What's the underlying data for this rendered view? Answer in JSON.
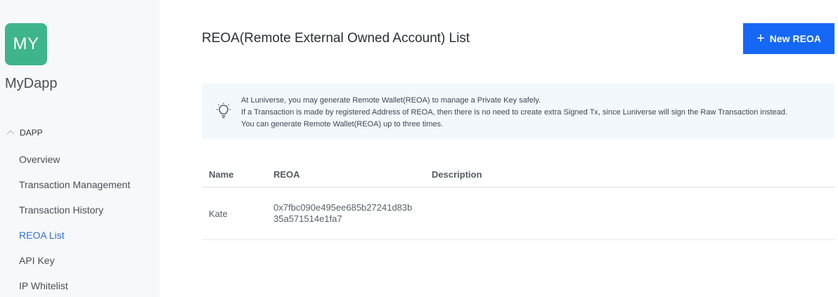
{
  "sidebar": {
    "avatar_text": "MY",
    "app_name": "MyDapp",
    "section_label": "DAPP",
    "items": [
      {
        "label": "Overview"
      },
      {
        "label": "Transaction Management"
      },
      {
        "label": "Transaction History"
      },
      {
        "label": "REOA List"
      },
      {
        "label": "API Key"
      },
      {
        "label": "IP Whitelist"
      }
    ],
    "active_item": "REOA List",
    "avatar_color": "#3fb58b",
    "active_color": "#2f6fd6"
  },
  "header": {
    "title": "REOA(Remote External Owned Account) List",
    "new_button_label": "New REOA",
    "button_color": "#1468f5"
  },
  "info": {
    "icon": "lightbulb-icon",
    "lines": [
      "At Luniverse, you may generate Remote Wallet(REOA) to manage a Private Key safely.",
      "If a Transaction is made by registered Address of REOA, then there is no need to create extra Signed Tx, since Luniverse will sign the Raw Transaction instead.",
      "You can generate Remote Wallet(REOA) up to three times."
    ]
  },
  "table": {
    "columns": [
      "Name",
      "REOA",
      "Description"
    ],
    "rows": [
      {
        "name": "Kate",
        "reoa": "0x7fbc090e495ee685b27241d83b35a571514e1fa7",
        "description": ""
      }
    ]
  }
}
